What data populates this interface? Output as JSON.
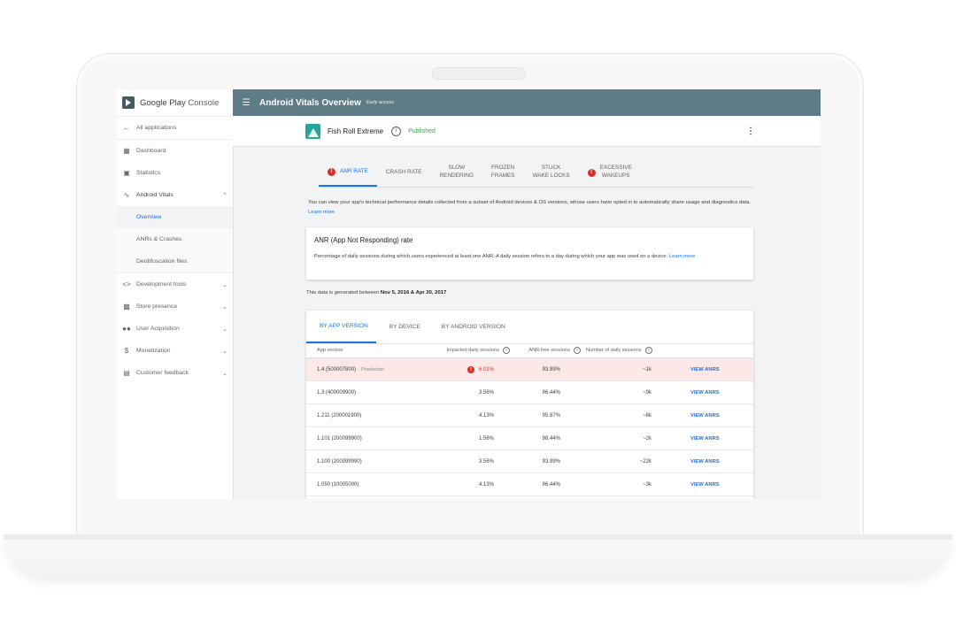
{
  "sidebar": {
    "brand": {
      "google": "Google Play",
      "console": "Console"
    },
    "items": [
      {
        "label": "All applications",
        "icon": "arrow-back-icon"
      },
      {
        "label": "Dashboard",
        "icon": "dashboard-icon"
      },
      {
        "label": "Statistics",
        "icon": "statistics-icon"
      },
      {
        "label": "Android Vitals",
        "icon": "pulse-icon"
      },
      {
        "label": "Development tools",
        "icon": "code-icon"
      },
      {
        "label": "Store presence",
        "icon": "shopping-bag-icon"
      },
      {
        "label": "User Acquisition",
        "icon": "people-icon"
      },
      {
        "label": "Monetization",
        "icon": "dollar-icon"
      },
      {
        "label": "Customer feedback",
        "icon": "feedback-icon"
      }
    ],
    "vitals_sub": [
      {
        "label": "Overview",
        "active": true
      },
      {
        "label": "ANRs & Crashes",
        "active": false
      },
      {
        "label": "Deobfuscation files",
        "active": false
      }
    ]
  },
  "topbar": {
    "title": "Android Vitals Overview",
    "tag": "Early access"
  },
  "app": {
    "name": "Fish Roll Extreme",
    "status": "Published"
  },
  "metric_tabs": [
    {
      "line1": "ANR RATE",
      "line2": "",
      "warning": true,
      "active": true
    },
    {
      "line1": "CRASH RATE",
      "line2": "",
      "warning": false,
      "active": false
    },
    {
      "line1": "SLOW",
      "line2": "RENDERING",
      "warning": false,
      "active": false
    },
    {
      "line1": "FROZEN",
      "line2": "FRAMES",
      "warning": false,
      "active": false
    },
    {
      "line1": "STUCK",
      "line2": "WAKE LOCKS",
      "warning": false,
      "active": false
    },
    {
      "line1": "EXCESSIVE",
      "line2": "WAKEUPS",
      "warning": true,
      "active": false
    }
  ],
  "description": {
    "text": "You can view your app's technical performance details collected from a subset of Android devices & OS versions, whose users have opted in to automatically share usage and diagnostics data.",
    "link": "Learn more"
  },
  "anr_card": {
    "title": "ANR (App Not Responding) rate",
    "body": "Percentage of daily sessions during which users experienced at least one ANR. A daily session refers to a day during which your app was used on a device.",
    "link": "Learn more"
  },
  "date_range": {
    "prefix": "This data is generated between",
    "range": "Nov 5, 2016 & Apr 20, 2017"
  },
  "breakdown_tabs": [
    {
      "label": "BY APP VERSION",
      "active": true
    },
    {
      "label": "BY DEVICE",
      "active": false
    },
    {
      "label": "BY ANDROID VERSION",
      "active": false
    }
  ],
  "table": {
    "headers": {
      "version": "App version",
      "impacted": "Impacted daily sessions",
      "anr_free": "ANR-free sessions",
      "daily": "Number of daily sessions"
    },
    "rows": [
      {
        "version": "1.4 (500007800)",
        "track": "Production",
        "impacted": "6.01%",
        "anr_free": "93.99%",
        "daily": "~1k",
        "action": "VIEW ANRS",
        "flagged": true
      },
      {
        "version": "1.3 (400009900)",
        "track": "",
        "impacted": "3.56%",
        "anr_free": "96.44%",
        "daily": "~9k",
        "action": "VIEW ANRS",
        "flagged": false
      },
      {
        "version": "1.211 (200001900)",
        "track": "",
        "impacted": "4.13%",
        "anr_free": "95.87%",
        "daily": "~8k",
        "action": "VIEW ANRS",
        "flagged": false
      },
      {
        "version": "1.101 (200099900)",
        "track": "",
        "impacted": "1.56%",
        "anr_free": "98.44%",
        "daily": "~2k",
        "action": "VIEW ANRS",
        "flagged": false
      },
      {
        "version": "1.100 (200099990)",
        "track": "",
        "impacted": "3.56%",
        "anr_free": "93.99%",
        "daily": "~22k",
        "action": "VIEW ANRS",
        "flagged": false
      },
      {
        "version": "1.050 (10005000)",
        "track": "",
        "impacted": "4.13%",
        "anr_free": "96.44%",
        "daily": "~3k",
        "action": "VIEW ANRS",
        "flagged": false
      }
    ]
  },
  "colors": {
    "topbar": "#5f7b85",
    "accent": "#1a73e8",
    "error": "#d93025",
    "published": "#43a047"
  }
}
